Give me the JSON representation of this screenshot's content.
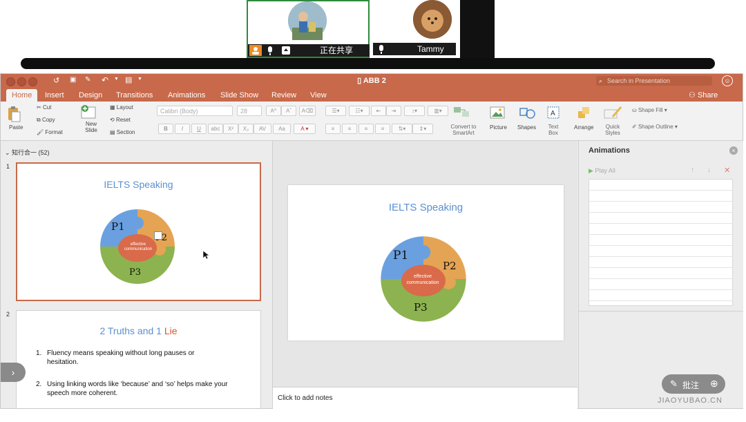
{
  "meeting": {
    "sharing_text": "正在共享",
    "participant_name": "Tammy"
  },
  "window": {
    "title": "ABB 2",
    "search_placeholder": "Search in Presentation",
    "share_label": "Share"
  },
  "tabs": [
    "Home",
    "Insert",
    "Design",
    "Transitions",
    "Animations",
    "Slide Show",
    "Review",
    "View"
  ],
  "ribbon": {
    "paste": "Paste",
    "cut": "Cut",
    "copy": "Copy",
    "format": "Format",
    "new_slide": "New Slide",
    "layout": "Layout",
    "reset": "Reset",
    "section": "Section",
    "font_name": "Calibri (Body)",
    "font_size": "28",
    "convert_smartart": "Convert to SmartArt",
    "picture": "Picture",
    "shapes": "Shapes",
    "text_box": "Text Box",
    "arrange": "Arrange",
    "quick_styles": "Quick Styles",
    "shape_fill": "Shape Fill",
    "shape_outline": "Shape Outline"
  },
  "thumbnails": {
    "section_label": "知行合一 (52)",
    "slides": [
      {
        "number": "1",
        "title": "IELTS Speaking",
        "center": "effective communication",
        "p1": "P1",
        "p2": "P2",
        "p3": "P3"
      },
      {
        "number": "2",
        "title_part1": "2 Truths and 1 ",
        "title_part2": "Lie",
        "item1": "Fluency means speaking without long pauses or hesitation.",
        "item2": "Using linking words like ‘because’ and ‘so’ helps make your speech more coherent."
      }
    ]
  },
  "editor": {
    "title": "IELTS Speaking",
    "center": "effective communication",
    "notes_placeholder": "Click to add notes"
  },
  "animations": {
    "title": "Animations",
    "play_all": "Play All"
  },
  "watermark": {
    "text": "JIAOYUBAO.CN",
    "annotate": "批注"
  },
  "colors": {
    "accent": "#c7694a",
    "blue": "#5b8fd0",
    "puzzle_blue": "#6aa0e0",
    "puzzle_orange": "#e5a453",
    "puzzle_green": "#8cb34f",
    "center_red": "#d96a4a",
    "lie_red": "#d9532c"
  }
}
